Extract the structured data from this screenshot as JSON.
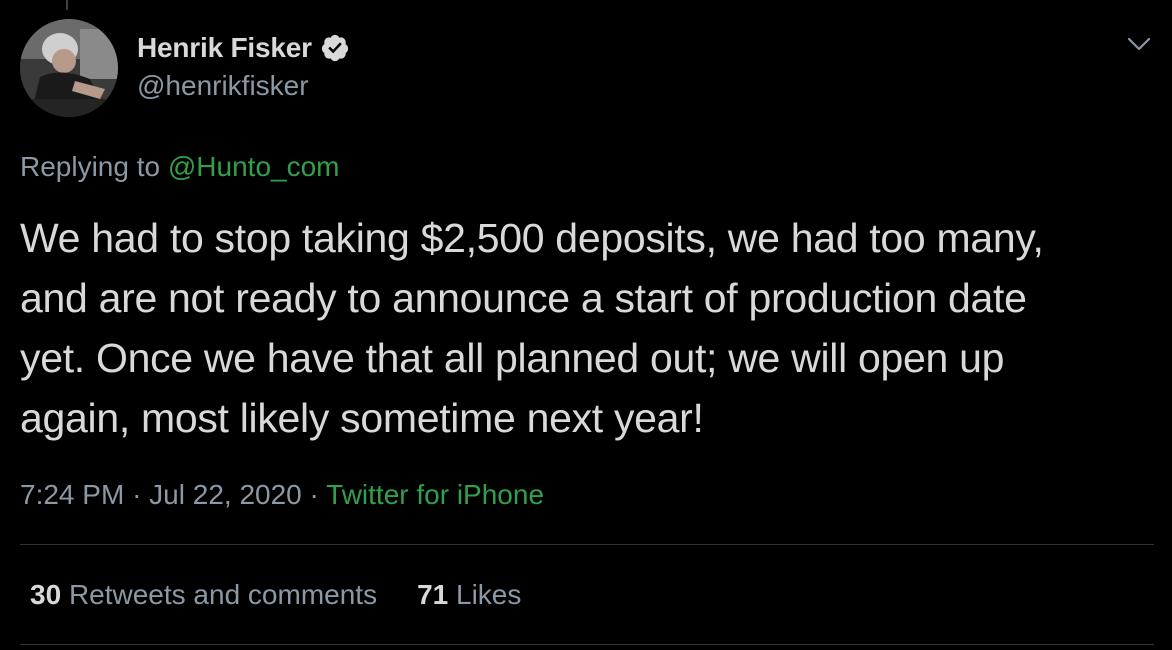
{
  "author": {
    "display_name": "Henrik Fisker",
    "handle": "@henrikfisker",
    "verified": true
  },
  "icons": {
    "verified": "verified-badge-icon",
    "more": "chevron-down-icon"
  },
  "reply": {
    "prefix": "Replying to",
    "handle": "@Hunto_com"
  },
  "tweet": {
    "lines": [
      "We had to stop taking $2,500 deposits, we had too many,",
      "and are not ready to announce a start of production date",
      "yet. Once we have that all planned out; we will open up",
      "again, most likely sometime next year!"
    ]
  },
  "meta": {
    "time": "7:24 PM",
    "separator": "·",
    "date": "Jul 22, 2020",
    "source": "Twitter for iPhone"
  },
  "stats": {
    "retweets_count": "30",
    "retweets_label": "Retweets and comments",
    "likes_count": "71",
    "likes_label": "Likes"
  },
  "colors": {
    "background": "#000000",
    "text": "#d9d9d9",
    "secondary_text": "#8b98a5",
    "link": "#31a04a",
    "divider": "#2f3336"
  }
}
